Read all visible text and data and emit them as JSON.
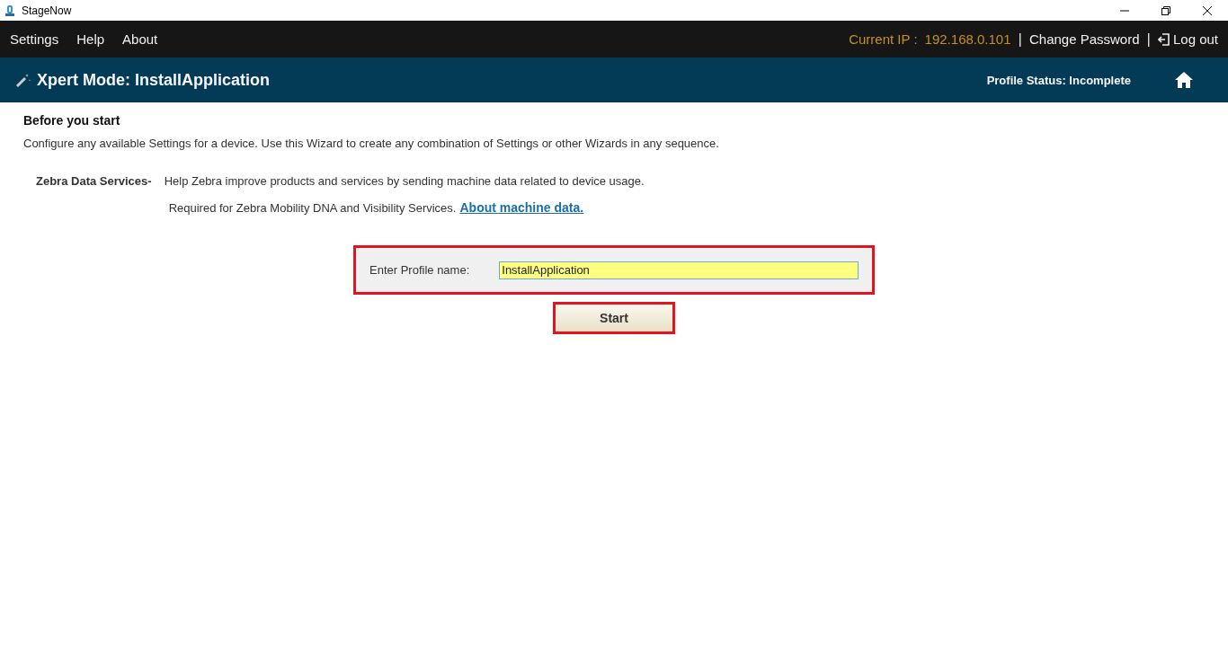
{
  "window": {
    "title": "StageNow"
  },
  "menu": [
    "Settings",
    "Help",
    "About"
  ],
  "account": {
    "ip_label": "Current IP :",
    "ip": "192.168.0.101",
    "separator": "|",
    "change_password": "Change Password",
    "separator_2": "|",
    "logout": "Log out"
  },
  "header": {
    "title": "Xpert Mode: InstallApplication",
    "status": "Profile Status: Incomplete"
  },
  "intro": {
    "heading": "Before you start",
    "text": "Configure any available Settings for a device. Use this Wizard to create any combination of Settings or other Wizards in any sequence."
  },
  "data_services": {
    "label": "Zebra Data Services-",
    "line_1": "Help Zebra improve products and services by sending machine data related to device usage.",
    "line_2": "Required for Zebra Mobility DNA and Visibility Services.",
    "link": "About machine data."
  },
  "profile": {
    "label": "Enter Profile name:",
    "value": "InstallApplication"
  },
  "buttons": [
    "Start"
  ]
}
